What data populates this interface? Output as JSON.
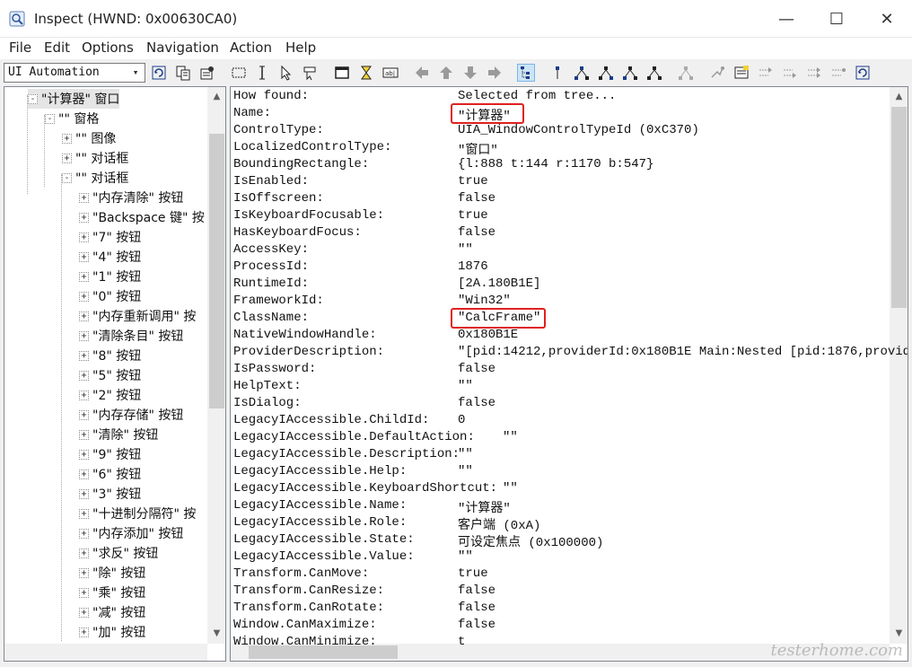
{
  "window": {
    "title": "Inspect  (HWND: 0x00630CA0)",
    "minimize": "—",
    "maximize": "☐",
    "close": "✕"
  },
  "menu": [
    "File",
    "Edit",
    "Options",
    "Navigation",
    "Action",
    "Help"
  ],
  "toolbar": {
    "mode_select": "UI Automation",
    "dropdown_arrow": "▾"
  },
  "tree": {
    "items": [
      {
        "text": "\"计算器\" 窗口",
        "level": 0,
        "expander": "-",
        "selected": true
      },
      {
        "text": "\"\" 窗格",
        "level": 1,
        "expander": "-"
      },
      {
        "text": "\"\" 图像",
        "level": 2,
        "expander": "+"
      },
      {
        "text": "\"\" 对话框",
        "level": 2,
        "expander": "+"
      },
      {
        "text": "\"\" 对话框",
        "level": 2,
        "expander": "-"
      },
      {
        "text": "\"内存清除\" 按钮",
        "level": 3,
        "expander": "+"
      },
      {
        "text": "\"Backspace 键\" 按",
        "level": 3,
        "expander": "+"
      },
      {
        "text": "\"7\" 按钮",
        "level": 3,
        "expander": "+"
      },
      {
        "text": "\"4\" 按钮",
        "level": 3,
        "expander": "+"
      },
      {
        "text": "\"1\" 按钮",
        "level": 3,
        "expander": "+"
      },
      {
        "text": "\"0\" 按钮",
        "level": 3,
        "expander": "+"
      },
      {
        "text": "\"内存重新调用\" 按",
        "level": 3,
        "expander": "+"
      },
      {
        "text": "\"清除条目\" 按钮",
        "level": 3,
        "expander": "+"
      },
      {
        "text": "\"8\" 按钮",
        "level": 3,
        "expander": "+"
      },
      {
        "text": "\"5\" 按钮",
        "level": 3,
        "expander": "+"
      },
      {
        "text": "\"2\" 按钮",
        "level": 3,
        "expander": "+"
      },
      {
        "text": "\"内存存储\" 按钮",
        "level": 3,
        "expander": "+"
      },
      {
        "text": "\"清除\" 按钮",
        "level": 3,
        "expander": "+"
      },
      {
        "text": "\"9\" 按钮",
        "level": 3,
        "expander": "+"
      },
      {
        "text": "\"6\" 按钮",
        "level": 3,
        "expander": "+"
      },
      {
        "text": "\"3\" 按钮",
        "level": 3,
        "expander": "+"
      },
      {
        "text": "\"十进制分隔符\" 按",
        "level": 3,
        "expander": "+"
      },
      {
        "text": "\"内存添加\" 按钮",
        "level": 3,
        "expander": "+"
      },
      {
        "text": "\"求反\" 按钮",
        "level": 3,
        "expander": "+"
      },
      {
        "text": "\"除\" 按钮",
        "level": 3,
        "expander": "+"
      },
      {
        "text": "\"乘\" 按钮",
        "level": 3,
        "expander": "+"
      },
      {
        "text": "\"减\" 按钮",
        "level": 3,
        "expander": "+"
      },
      {
        "text": "\"加\" 按钮",
        "level": 3,
        "expander": "+"
      }
    ]
  },
  "properties": [
    {
      "name": "How found:",
      "value": "Selected from tree..."
    },
    {
      "name": "Name:",
      "value": "\"计算器\"",
      "highlight": true
    },
    {
      "name": "ControlType:",
      "value": "UIA_WindowControlTypeId (0xC370)"
    },
    {
      "name": "LocalizedControlType:",
      "value": "\"窗口\""
    },
    {
      "name": "BoundingRectangle:",
      "value": "{l:888 t:144 r:1170 b:547}"
    },
    {
      "name": "IsEnabled:",
      "value": "true"
    },
    {
      "name": "IsOffscreen:",
      "value": "false"
    },
    {
      "name": "IsKeyboardFocusable:",
      "value": "true"
    },
    {
      "name": "HasKeyboardFocus:",
      "value": "false"
    },
    {
      "name": "AccessKey:",
      "value": "\"\""
    },
    {
      "name": "ProcessId:",
      "value": "1876"
    },
    {
      "name": "RuntimeId:",
      "value": "[2A.180B1E]"
    },
    {
      "name": "FrameworkId:",
      "value": "\"Win32\""
    },
    {
      "name": "ClassName:",
      "value": "\"CalcFrame\"",
      "highlight": true
    },
    {
      "name": "NativeWindowHandle:",
      "value": "0x180B1E"
    },
    {
      "name": "ProviderDescription:",
      "value": "\"[pid:14212,providerId:0x180B1E Main:Nested [pid:1876,provid"
    },
    {
      "name": "IsPassword:",
      "value": "false"
    },
    {
      "name": "HelpText:",
      "value": "\"\""
    },
    {
      "name": "IsDialog:",
      "value": "false"
    },
    {
      "name": "LegacyIAccessible.ChildId:",
      "value": "0"
    },
    {
      "name": "LegacyIAccessible.DefaultAction:",
      "value": "\"\"",
      "offset": "wide"
    },
    {
      "name": "LegacyIAccessible.Description:",
      "value": "\"\""
    },
    {
      "name": "LegacyIAccessible.Help:",
      "value": "\"\""
    },
    {
      "name": "LegacyIAccessible.KeyboardShortcut:",
      "value": "\"\"",
      "offset": "wide"
    },
    {
      "name": "LegacyIAccessible.Name:",
      "value": "\"计算器\""
    },
    {
      "name": "LegacyIAccessible.Role:",
      "value": "客户端 (0xA)"
    },
    {
      "name": "LegacyIAccessible.State:",
      "value": "可设定焦点 (0x100000)"
    },
    {
      "name": "LegacyIAccessible.Value:",
      "value": "\"\""
    },
    {
      "name": "Transform.CanMove:",
      "value": "true"
    },
    {
      "name": "Transform.CanResize:",
      "value": "false"
    },
    {
      "name": "Transform.CanRotate:",
      "value": "false"
    },
    {
      "name": "Window.CanMaximize:",
      "value": "false"
    },
    {
      "name": "Window.CanMinimize:",
      "value": "t"
    }
  ],
  "watermark": "testerhome.com",
  "colors": {
    "highlight": "#e02020",
    "selection": "#e5e5e5"
  }
}
